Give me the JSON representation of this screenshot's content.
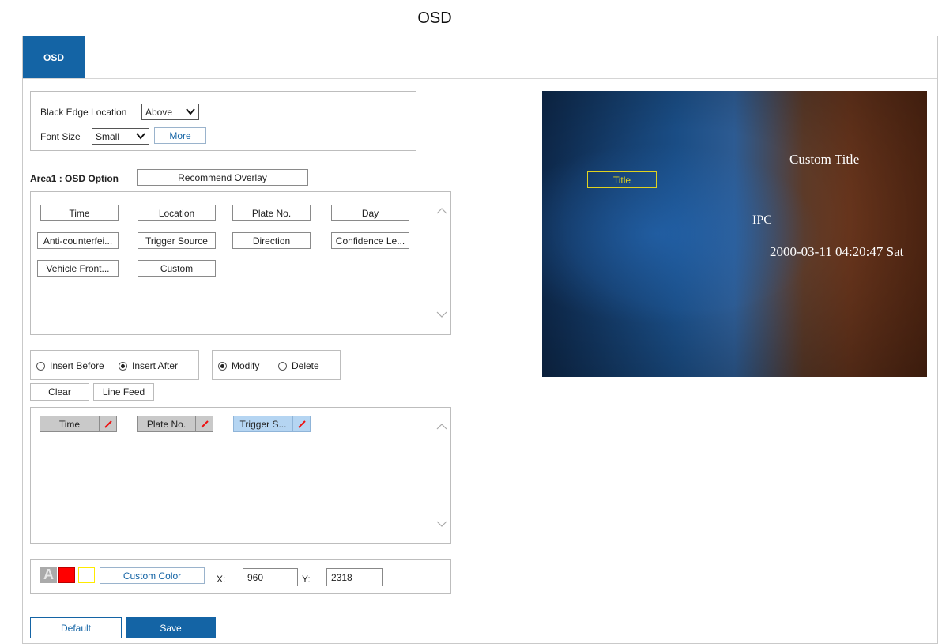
{
  "page": {
    "title": "OSD"
  },
  "tabs": [
    {
      "label": "OSD",
      "active": true
    }
  ],
  "display": {
    "black_edge_label": "Black Edge Location",
    "black_edge_value": "Above",
    "font_size_label": "Font Size",
    "font_size_value": "Small",
    "more_label": "More"
  },
  "area": {
    "label": "Area1 : OSD Option",
    "recommend_label": "Recommend Overlay"
  },
  "osd_options": [
    "Time",
    "Location",
    "Plate No.",
    "Day",
    "Anti-counterfei...",
    "Trigger Source",
    "Direction",
    "Confidence Le...",
    "Vehicle Front...",
    "Custom"
  ],
  "insert": {
    "before_label": "Insert Before",
    "after_label": "Insert After",
    "selected": "after"
  },
  "edit_mode": {
    "modify_label": "Modify",
    "delete_label": "Delete",
    "selected": "modify"
  },
  "actions": {
    "clear_label": "Clear",
    "line_feed_label": "Line Feed"
  },
  "selected_items": [
    {
      "label": "Time",
      "state": "gray"
    },
    {
      "label": "Plate No.",
      "state": "gray"
    },
    {
      "label": "Trigger S...",
      "state": "selected"
    }
  ],
  "color": {
    "font_letter": "A",
    "font_color": "#ff0000",
    "background_color": "#ffff66",
    "custom_label": "Custom Color",
    "x_label": "X:",
    "x_value": "960",
    "y_label": "Y:",
    "y_value": "2318"
  },
  "buttons": {
    "default_label": "Default",
    "save_label": "Save"
  },
  "preview": {
    "title_box": "Title",
    "custom_title": "Custom Title",
    "ipc": "IPC",
    "datetime": "2000-03-11 04:20:47 Sat"
  },
  "theme": {
    "accent": "#1464a5",
    "overlay_yellow": "#e0d21f"
  }
}
